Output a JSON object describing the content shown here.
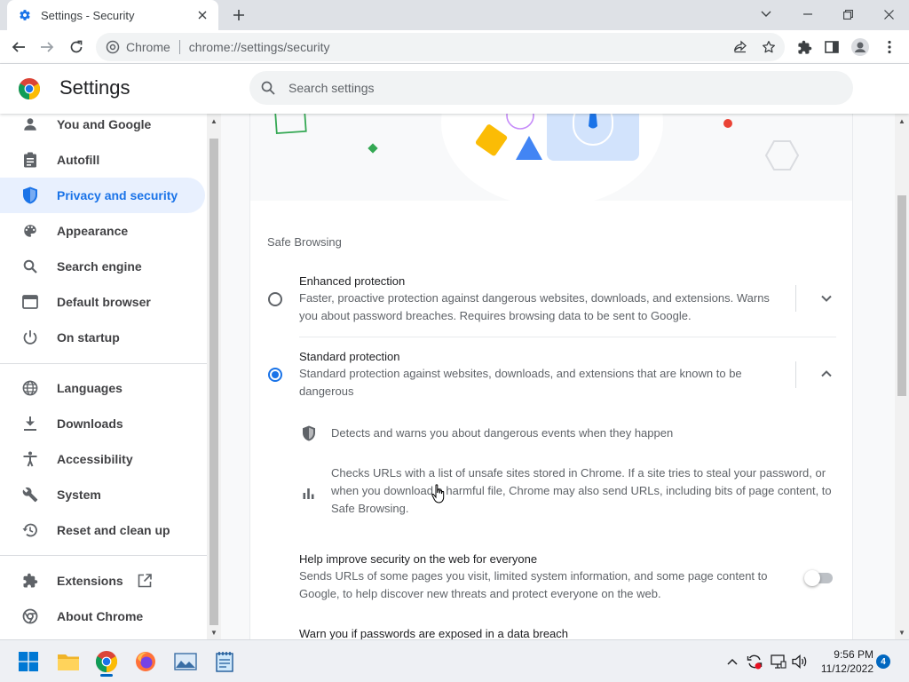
{
  "browser": {
    "tab_title": "Settings - Security",
    "omnibox_chip": "Chrome",
    "url": "chrome://settings/security"
  },
  "settings": {
    "title": "Settings",
    "search_placeholder": "Search settings"
  },
  "sidebar": {
    "items": [
      {
        "label": "You and Google",
        "icon": "person-icon"
      },
      {
        "label": "Autofill",
        "icon": "clipboard-icon"
      },
      {
        "label": "Privacy and security",
        "icon": "shield-icon",
        "active": true
      },
      {
        "label": "Appearance",
        "icon": "palette-icon"
      },
      {
        "label": "Search engine",
        "icon": "search-icon"
      },
      {
        "label": "Default browser",
        "icon": "browser-icon"
      },
      {
        "label": "On startup",
        "icon": "power-icon"
      },
      {
        "label": "Languages",
        "icon": "globe-icon"
      },
      {
        "label": "Downloads",
        "icon": "download-icon"
      },
      {
        "label": "Accessibility",
        "icon": "accessibility-icon"
      },
      {
        "label": "System",
        "icon": "wrench-icon"
      },
      {
        "label": "Reset and clean up",
        "icon": "restore-icon"
      },
      {
        "label": "Extensions",
        "icon": "puzzle-icon"
      },
      {
        "label": "About Chrome",
        "icon": "chrome-icon"
      }
    ]
  },
  "safe_browsing": {
    "section_title": "Safe Browsing",
    "enhanced": {
      "title": "Enhanced protection",
      "description": "Faster, proactive protection against dangerous websites, downloads, and extensions. Warns you about password breaches. Requires browsing data to be sent to Google.",
      "selected": false
    },
    "standard": {
      "title": "Standard protection",
      "description": "Standard protection against websites, downloads, and extensions that are known to be dangerous",
      "selected": true,
      "features": [
        "Detects and warns you about dangerous events when they happen",
        "Checks URLs with a list of unsafe sites stored in Chrome. If a site tries to steal your password, or when you download a harmful file, Chrome may also send URLs, including bits of page content, to Safe Browsing."
      ]
    },
    "help_improve": {
      "title": "Help improve security on the web for everyone",
      "description": "Sends URLs of some pages you visit, limited system information, and some page content to Google, to help discover new threats and protect everyone on the web.",
      "enabled": false
    },
    "password_warning": {
      "title": "Warn you if passwords are exposed in a data breach"
    }
  },
  "taskbar": {
    "time": "9:56 PM",
    "date": "11/12/2022",
    "notifications": "4"
  },
  "colors": {
    "accent": "#1a73e8",
    "active_nav_bg": "#e8f0fe"
  }
}
